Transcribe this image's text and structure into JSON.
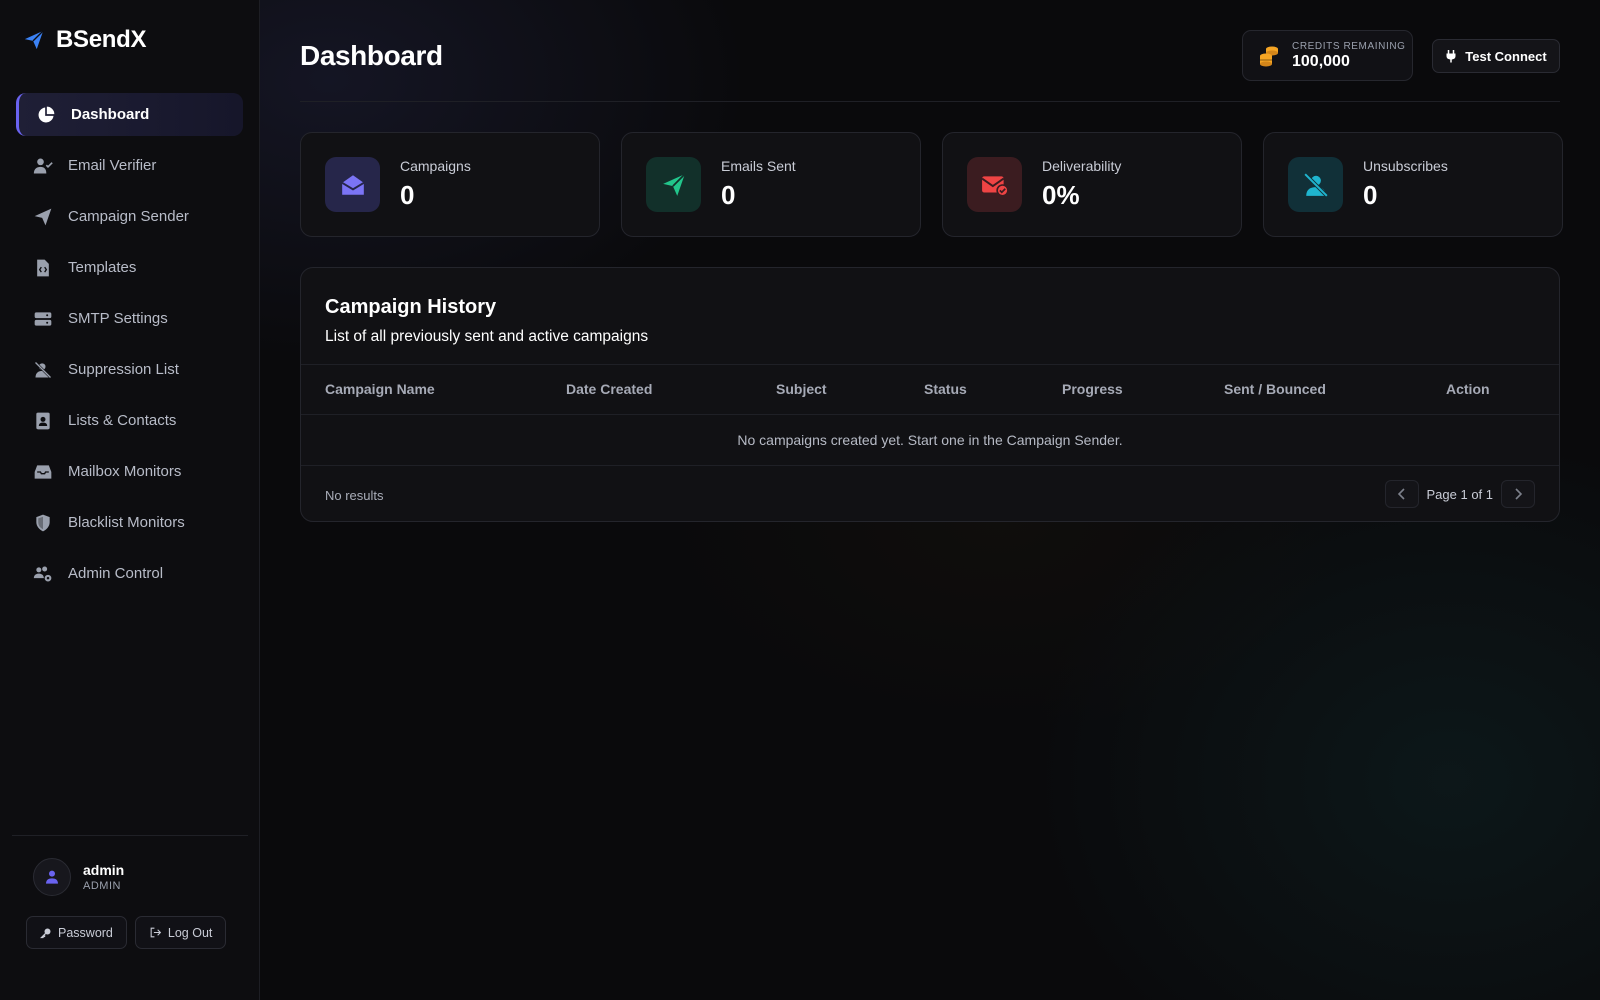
{
  "colors": {
    "accent": "#6a63f0",
    "campaigns_icon_bg": "#26264a",
    "emails_icon_bg": "#12302a",
    "deliverability_icon_bg": "#3b1c20",
    "unsubscribes_icon_bg": "#113038"
  },
  "brand": {
    "name": "BSendX",
    "icon": "paper-plane-icon"
  },
  "sidebar": {
    "items": [
      {
        "label": "Dashboard",
        "icon": "pie-chart-icon",
        "active": true
      },
      {
        "label": "Email Verifier",
        "icon": "user-check-icon"
      },
      {
        "label": "Campaign Sender",
        "icon": "paper-plane-icon"
      },
      {
        "label": "Templates",
        "icon": "file-code-icon"
      },
      {
        "label": "SMTP Settings",
        "icon": "server-icon"
      },
      {
        "label": "Suppression List",
        "icon": "user-slash-icon"
      },
      {
        "label": "Lists & Contacts",
        "icon": "address-book-icon"
      },
      {
        "label": "Mailbox Monitors",
        "icon": "inbox-icon"
      },
      {
        "label": "Blacklist Monitors",
        "icon": "shield-icon"
      },
      {
        "label": "Admin Control",
        "icon": "users-gear-icon"
      }
    ]
  },
  "user": {
    "name": "admin",
    "role": "ADMIN",
    "password_label": "Password",
    "logout_label": "Log Out"
  },
  "header": {
    "title": "Dashboard",
    "credits_label": "CREDITS REMAINING",
    "credits_value": "100,000",
    "test_connect_label": "Test Connect"
  },
  "stats": [
    {
      "label": "Campaigns",
      "value": "0",
      "icon": "envelope-open-icon"
    },
    {
      "label": "Emails Sent",
      "value": "0",
      "icon": "paper-plane-icon"
    },
    {
      "label": "Deliverability",
      "value": "0%",
      "icon": "envelope-check-icon"
    },
    {
      "label": "Unsubscribes",
      "value": "0",
      "icon": "user-slash-icon"
    }
  ],
  "history": {
    "title": "Campaign History",
    "subtitle": "List of all previously sent and active campaigns",
    "columns": [
      "Campaign Name",
      "Date Created",
      "Subject",
      "Status",
      "Progress",
      "Sent / Bounced",
      "Action"
    ],
    "empty_text": "No campaigns created yet. Start one in the Campaign Sender.",
    "no_results": "No results",
    "page_text": "Page 1 of 1"
  }
}
